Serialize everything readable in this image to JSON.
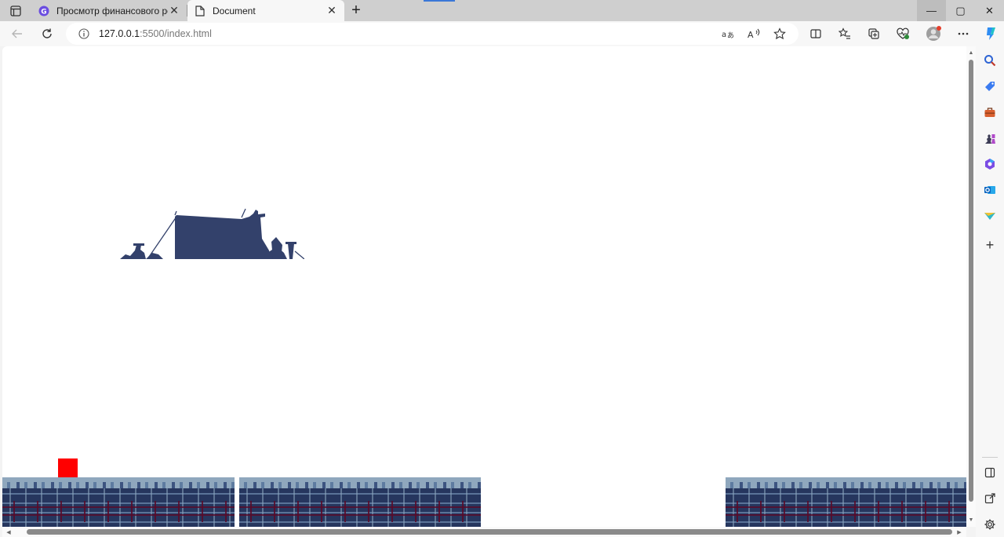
{
  "browser": {
    "tabs": [
      {
        "title": "Просмотр финансового резуль",
        "active": false,
        "favicon": "g-logo-icon"
      },
      {
        "title": "Document",
        "active": true,
        "favicon": "document-icon"
      }
    ],
    "address": {
      "host": "127.0.0.1",
      "rest": ":5500/index.html"
    },
    "window_controls": {
      "minimize": "—",
      "maximize": "▢",
      "close": "✕"
    }
  },
  "game": {
    "player": {
      "color": "#ff0000"
    },
    "ground_color": "#26365e",
    "ground_highlight": "#8fa7bd",
    "background_ship_color": "#33416b"
  },
  "colors": {
    "accent": "#3b78d8",
    "copilot": "#2f8df3"
  }
}
